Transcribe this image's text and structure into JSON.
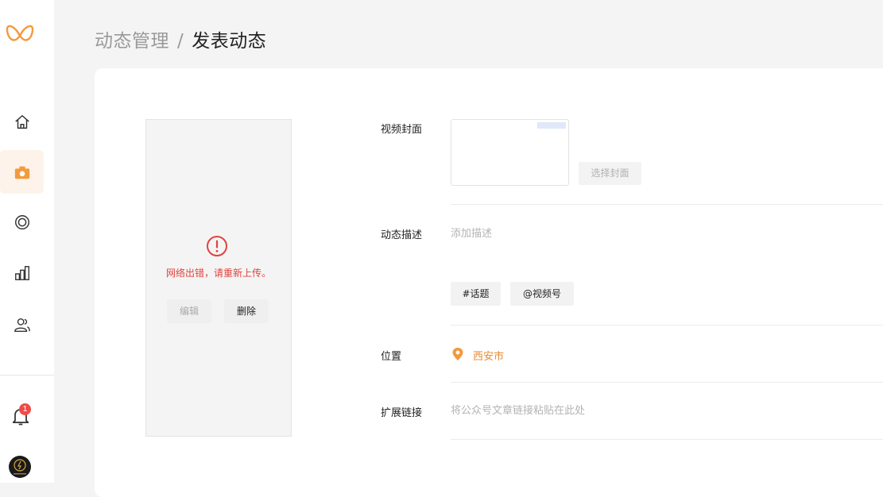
{
  "brand": {
    "accent_color": "#f39a3d",
    "error_color": "#e0433f"
  },
  "sidebar": {
    "items": [
      {
        "name": "home",
        "icon": "home-icon",
        "active": false
      },
      {
        "name": "camera",
        "icon": "camera-icon",
        "active": true
      },
      {
        "name": "live",
        "icon": "live-circle-icon",
        "active": false
      },
      {
        "name": "stats",
        "icon": "bar-chart-icon",
        "active": false
      },
      {
        "name": "users",
        "icon": "users-icon",
        "active": false
      }
    ],
    "notification_count": "1"
  },
  "breadcrumb": {
    "parent": "动态管理",
    "separator": "/",
    "current": "发表动态"
  },
  "video_panel": {
    "error_message": "网络出错，请重新上传。",
    "edit_label": "编辑",
    "delete_label": "删除"
  },
  "form": {
    "cover": {
      "label": "视频封面",
      "select_label": "选择封面"
    },
    "description": {
      "label": "动态描述",
      "placeholder": "添加描述",
      "topic_label": "#话题",
      "mention_label": "@视频号"
    },
    "location": {
      "label": "位置",
      "value": "西安市"
    },
    "link": {
      "label": "扩展链接",
      "placeholder": "将公众号文章链接粘贴在此处"
    }
  }
}
